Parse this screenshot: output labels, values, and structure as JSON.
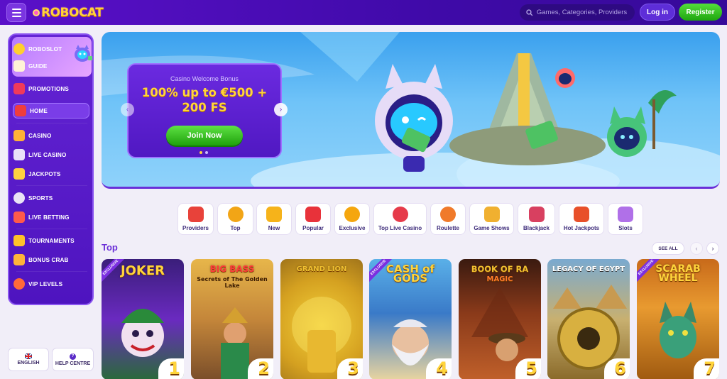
{
  "header": {
    "logo_text": "ROBOCAT",
    "search_placeholder": "Games, Categories, Providers",
    "login_label": "Log in",
    "register_label": "Register"
  },
  "sidebar": {
    "items": [
      {
        "label": "ROBOSLOT",
        "icon": "coin-icon"
      },
      {
        "label": "GUIDE",
        "icon": "guide-icon"
      },
      {
        "label": "PROMOTIONS",
        "icon": "gift-icon"
      },
      {
        "label": "HOME",
        "icon": "home-icon"
      },
      {
        "label": "CASINO",
        "icon": "dice-icon"
      },
      {
        "label": "LIVE CASINO",
        "icon": "cards-icon"
      },
      {
        "label": "JACKPOTS",
        "icon": "jackpot-icon"
      },
      {
        "label": "SPORTS",
        "icon": "ball-icon"
      },
      {
        "label": "LIVE BETTING",
        "icon": "live-icon"
      },
      {
        "label": "TOURNAMENTS",
        "icon": "trophy-icon"
      },
      {
        "label": "BONUS CRAB",
        "icon": "crab-icon"
      },
      {
        "label": "VIP LEVELS",
        "icon": "vip-icon"
      }
    ],
    "language_label": "ENGLISH",
    "help_label": "HELP CENTRE"
  },
  "hero": {
    "subtitle": "Casino Welcome Bonus",
    "headline_line1": "100% up to €500 +",
    "headline_line2": "200 FS",
    "cta_label": "Join Now"
  },
  "categories": [
    {
      "label": "Providers",
      "color": "#e8423a"
    },
    {
      "label": "Top",
      "color": "#f2a516"
    },
    {
      "label": "New",
      "color": "#f6b31a"
    },
    {
      "label": "Popular",
      "color": "#e8323a"
    },
    {
      "label": "Exclusive",
      "color": "#f5a60e"
    },
    {
      "label": "Top Live Casino",
      "color": "#e63a4a"
    },
    {
      "label": "Roulette",
      "color": "#f07a2a"
    },
    {
      "label": "Game Shows",
      "color": "#f0b030"
    },
    {
      "label": "Blackjack",
      "color": "#d84060"
    },
    {
      "label": "Hot Jackpots",
      "color": "#e8502a"
    },
    {
      "label": "Slots",
      "color": "#b070e8"
    }
  ],
  "top_section": {
    "title": "Top",
    "see_all_label": "SEE ALL",
    "games": [
      {
        "title": "JOKER",
        "subtitle": "",
        "rank": "1",
        "badge": "EXCLUSIVE"
      },
      {
        "title": "BIG BASS",
        "subtitle": "Secrets of The Golden Lake",
        "rank": "2",
        "badge": ""
      },
      {
        "title": "GRAND LION",
        "subtitle": "",
        "rank": "3",
        "badge": ""
      },
      {
        "title": "CASH of GODS",
        "subtitle": "",
        "rank": "4",
        "badge": "EXCLUSIVE"
      },
      {
        "title": "BOOK OF RA",
        "subtitle": "MAGIC",
        "rank": "5",
        "badge": ""
      },
      {
        "title": "LEGACY OF EGYPT",
        "subtitle": "",
        "rank": "6",
        "badge": ""
      },
      {
        "title": "SCARAB WHEEL",
        "subtitle": "",
        "rank": "7",
        "badge": "EXCLUSIVE"
      }
    ]
  }
}
